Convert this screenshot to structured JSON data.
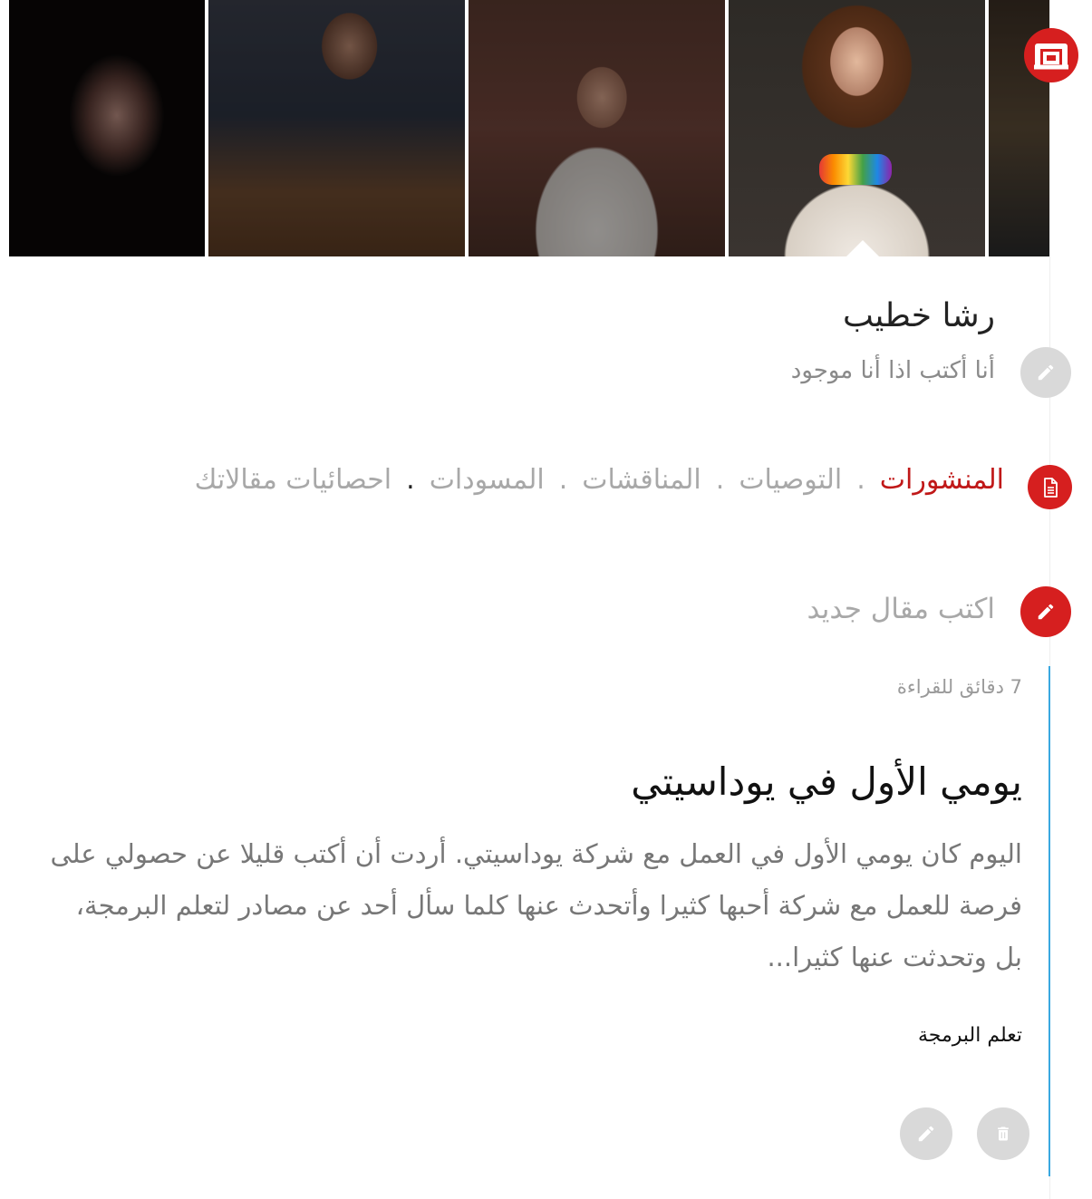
{
  "profile": {
    "name": "رشا خطيب",
    "bio": "أنا أكتب اذا أنا موجود"
  },
  "tabs": {
    "items": [
      {
        "label": "المنشورات",
        "active": true
      },
      {
        "label": "التوصيات",
        "active": false
      },
      {
        "label": "المناقشات",
        "active": false
      },
      {
        "label": "المسودات",
        "active": false
      },
      {
        "label": "احصائيات مقالاتك",
        "active": false
      }
    ],
    "separator": "."
  },
  "compose": {
    "label": "اكتب مقال جديد"
  },
  "post": {
    "read_time": "7 دقائق للقراءة",
    "title": "يومي الأول في يوداسيتي",
    "excerpt": " اليوم كان يومي الأول في العمل مع شركة يوداسيتي. أردت أن أكتب قليلا عن حصولي على فرصة للعمل مع شركة أحبها كثيرا وأتحدث عنها كلما سأل أحد عن مصادر لتعلم البرمجة، بل وتحدثت عنها كثيرا...",
    "tag": "تعلم البرمجة"
  },
  "colors": {
    "accent_red": "#d61f1f",
    "active_tab": "#c01818",
    "card_line": "#3aa8e0",
    "muted_text": "#a8a8a8"
  },
  "icons": {
    "logo": "brand-logo",
    "edit_bio": "pencil-icon",
    "posts_tab": "document-icon",
    "compose": "pencil-icon",
    "edit_post": "pencil-icon",
    "delete_post": "trash-icon"
  }
}
